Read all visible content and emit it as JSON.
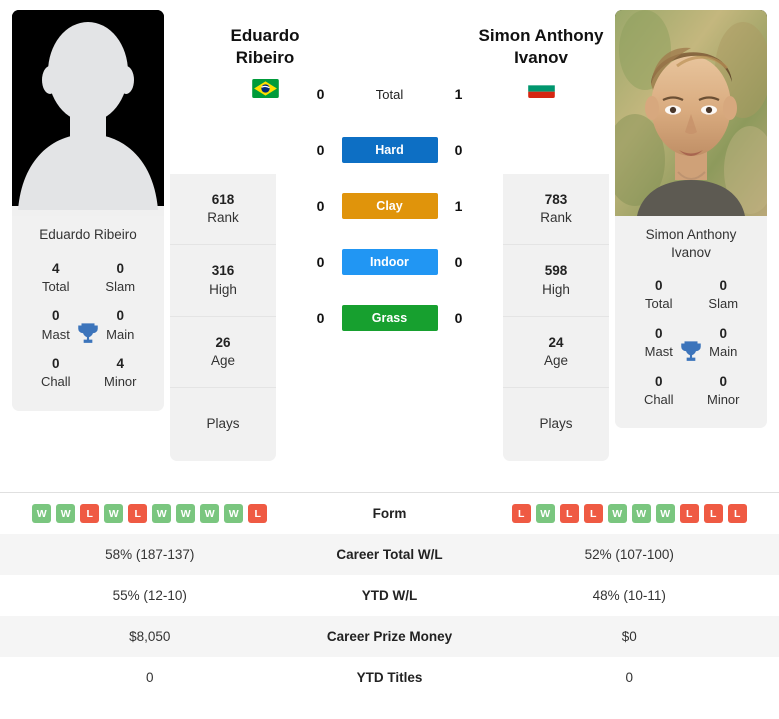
{
  "players": {
    "left": {
      "name_line1": "Eduardo",
      "name_line2": "Ribeiro",
      "full_name": "Eduardo Ribeiro",
      "country": "Brazil",
      "flag": "brazil-flag",
      "avatar": "default-silhouette-avatar",
      "rank": "618",
      "rank_label": "Rank",
      "high": "316",
      "high_label": "High",
      "age": "26",
      "age_label": "Age",
      "plays": "",
      "plays_label": "Plays",
      "titles": {
        "total": "4",
        "total_label": "Total",
        "slam": "0",
        "slam_label": "Slam",
        "mast": "0",
        "mast_label": "Mast",
        "main": "0",
        "main_label": "Main",
        "chall": "0",
        "chall_label": "Chall",
        "minor": "4",
        "minor_label": "Minor"
      }
    },
    "right": {
      "name_line1": "Simon Anthony",
      "name_line2": "Ivanov",
      "full_name_line1": "Simon Anthony",
      "full_name_line2": "Ivanov",
      "country": "Bulgaria",
      "flag": "bulgaria-flag",
      "avatar": "player-photo",
      "rank": "783",
      "rank_label": "Rank",
      "high": "598",
      "high_label": "High",
      "age": "24",
      "age_label": "Age",
      "plays": "",
      "plays_label": "Plays",
      "titles": {
        "total": "0",
        "total_label": "Total",
        "slam": "0",
        "slam_label": "Slam",
        "mast": "0",
        "mast_label": "Mast",
        "main": "0",
        "main_label": "Main",
        "chall": "0",
        "chall_label": "Chall",
        "minor": "0",
        "minor_label": "Minor"
      }
    }
  },
  "head_to_head": [
    {
      "label": "Total",
      "left": "0",
      "right": "1",
      "color": "transparent"
    },
    {
      "label": "Hard",
      "left": "0",
      "right": "0",
      "color": "#0d6fc4"
    },
    {
      "label": "Clay",
      "left": "0",
      "right": "1",
      "color": "#e0940b"
    },
    {
      "label": "Indoor",
      "left": "0",
      "right": "0",
      "color": "#2196f3"
    },
    {
      "label": "Grass",
      "left": "0",
      "right": "0",
      "color": "#17a02f"
    }
  ],
  "comparison": {
    "form": {
      "label": "Form",
      "left": [
        "W",
        "W",
        "L",
        "W",
        "L",
        "W",
        "W",
        "W",
        "W",
        "L"
      ],
      "right": [
        "L",
        "W",
        "L",
        "L",
        "W",
        "W",
        "W",
        "L",
        "L",
        "L"
      ]
    },
    "rows": [
      {
        "label": "Career Total W/L",
        "left": "58% (187-137)",
        "right": "52% (107-100)"
      },
      {
        "label": "YTD W/L",
        "left": "55% (12-10)",
        "right": "48% (10-11)"
      },
      {
        "label": "Career Prize Money",
        "left": "$8,050",
        "right": "$0"
      },
      {
        "label": "YTD Titles",
        "left": "0",
        "right": "0"
      }
    ]
  },
  "colors": {
    "win": "#7ac67f",
    "loss": "#ef5a43",
    "hard": "#0d6fc4",
    "clay": "#e0940b",
    "indoor": "#2196f3",
    "grass": "#17a02f",
    "panel": "#f1f1f1"
  }
}
